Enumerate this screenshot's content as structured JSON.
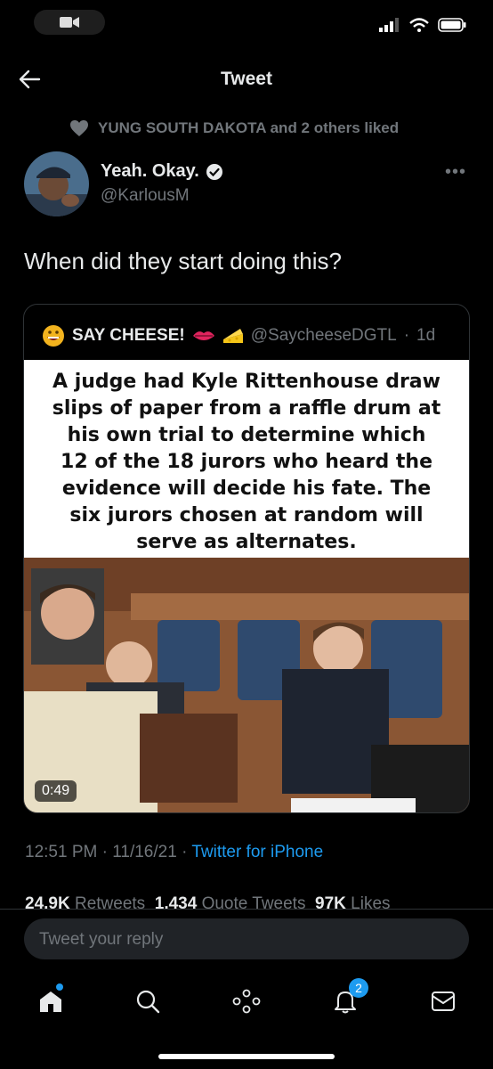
{
  "header": {
    "title": "Tweet"
  },
  "social_context": {
    "text": "YUNG SOUTH DAKOTA and 2 others liked"
  },
  "author": {
    "display_name": "Yeah. Okay.",
    "handle": "@KarlousM"
  },
  "tweet": {
    "text": "When did they start doing this?"
  },
  "quote": {
    "name": "SAY CHEESE!",
    "handle": "@SaycheeseDGTL",
    "age": "1d",
    "media_caption": "A judge had Kyle Rittenhouse draw slips of paper from a raffle drum at his own trial to determine which 12 of the 18 jurors who heard the evidence will decide his fate. The six jurors chosen at random will serve as alternates.",
    "duration": "0:49"
  },
  "meta": {
    "time": "12:51 PM",
    "date": "11/16/21",
    "source": "Twitter for iPhone"
  },
  "stats": {
    "retweets_count": "24.9K",
    "retweets_label": "Retweets",
    "quotes_count": "1,434",
    "quotes_label": "Quote Tweets",
    "likes_count": "97K",
    "likes_label": "Likes"
  },
  "reply": {
    "placeholder": "Tweet your reply"
  },
  "tabbar": {
    "notifications_badge": "2"
  },
  "colors": {
    "accent": "#1d9bf0",
    "muted": "#71767b",
    "background": "#000000"
  }
}
